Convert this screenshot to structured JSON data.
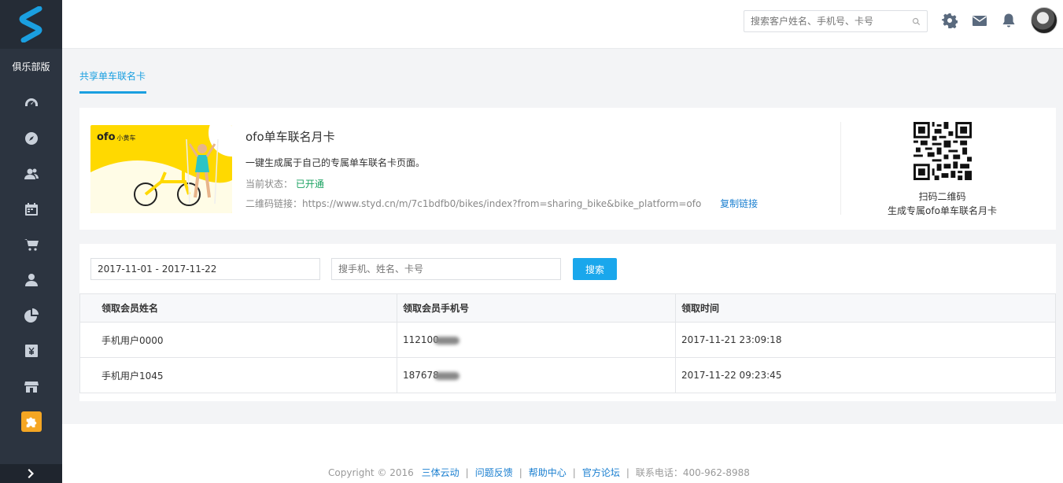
{
  "sidebar": {
    "edition": "俱乐部版",
    "items": [
      {
        "name": "dashboard-icon"
      },
      {
        "name": "compass-icon"
      },
      {
        "name": "users-icon"
      },
      {
        "name": "calendar-icon"
      },
      {
        "name": "cart-icon"
      },
      {
        "name": "user-icon"
      },
      {
        "name": "pie-chart-icon"
      },
      {
        "name": "yen-icon"
      },
      {
        "name": "store-icon"
      },
      {
        "name": "puzzle-icon",
        "active": true
      }
    ]
  },
  "header": {
    "search_placeholder": "搜索客户姓名、手机号、卡号"
  },
  "tabs": [
    {
      "label": "共享单车联名卡",
      "active": true
    }
  ],
  "card": {
    "brand": "ofo",
    "brand_sub": "小黄车",
    "title": "ofo单车联名月卡",
    "desc": "一键生成属于自己的专属单车联名卡页面。",
    "status_label": "当前状态：",
    "status_value": "已开通",
    "qr_link_label": "二维码链接：",
    "qr_link": "https://www.styd.cn/m/7c1bdfb0/bikes/index?from=sharing_bike&bike_platform=ofo",
    "copy_link": "复制链接",
    "qr_line1": "扫码二维码",
    "qr_line2": "生成专属ofo单车联名月卡"
  },
  "filter": {
    "date_range": "2017-11-01 - 2017-11-22",
    "keyword_placeholder": "搜手机、姓名、卡号",
    "search_button": "搜索"
  },
  "table": {
    "headers": [
      "领取会员姓名",
      "领取会员手机号",
      "领取时间"
    ],
    "rows": [
      {
        "name": "手机用户0000",
        "phone": "112100",
        "time": "2017-11-21 23:09:18"
      },
      {
        "name": "手机用户1045",
        "phone": "187678",
        "time": "2017-11-22 09:23:45"
      }
    ]
  },
  "footer": {
    "copyright": "Copyright © 2016",
    "links": [
      "三体云动",
      "问题反馈",
      "帮助中心",
      "官方论坛"
    ],
    "phone": "联系电话：400-962-8988"
  },
  "colors": {
    "sidebar_bg": "#2c3440",
    "accent": "#1aa7ec",
    "brand_yellow": "#ffd900",
    "active_nav": "#f5a623",
    "status_ok": "#1aa260"
  }
}
